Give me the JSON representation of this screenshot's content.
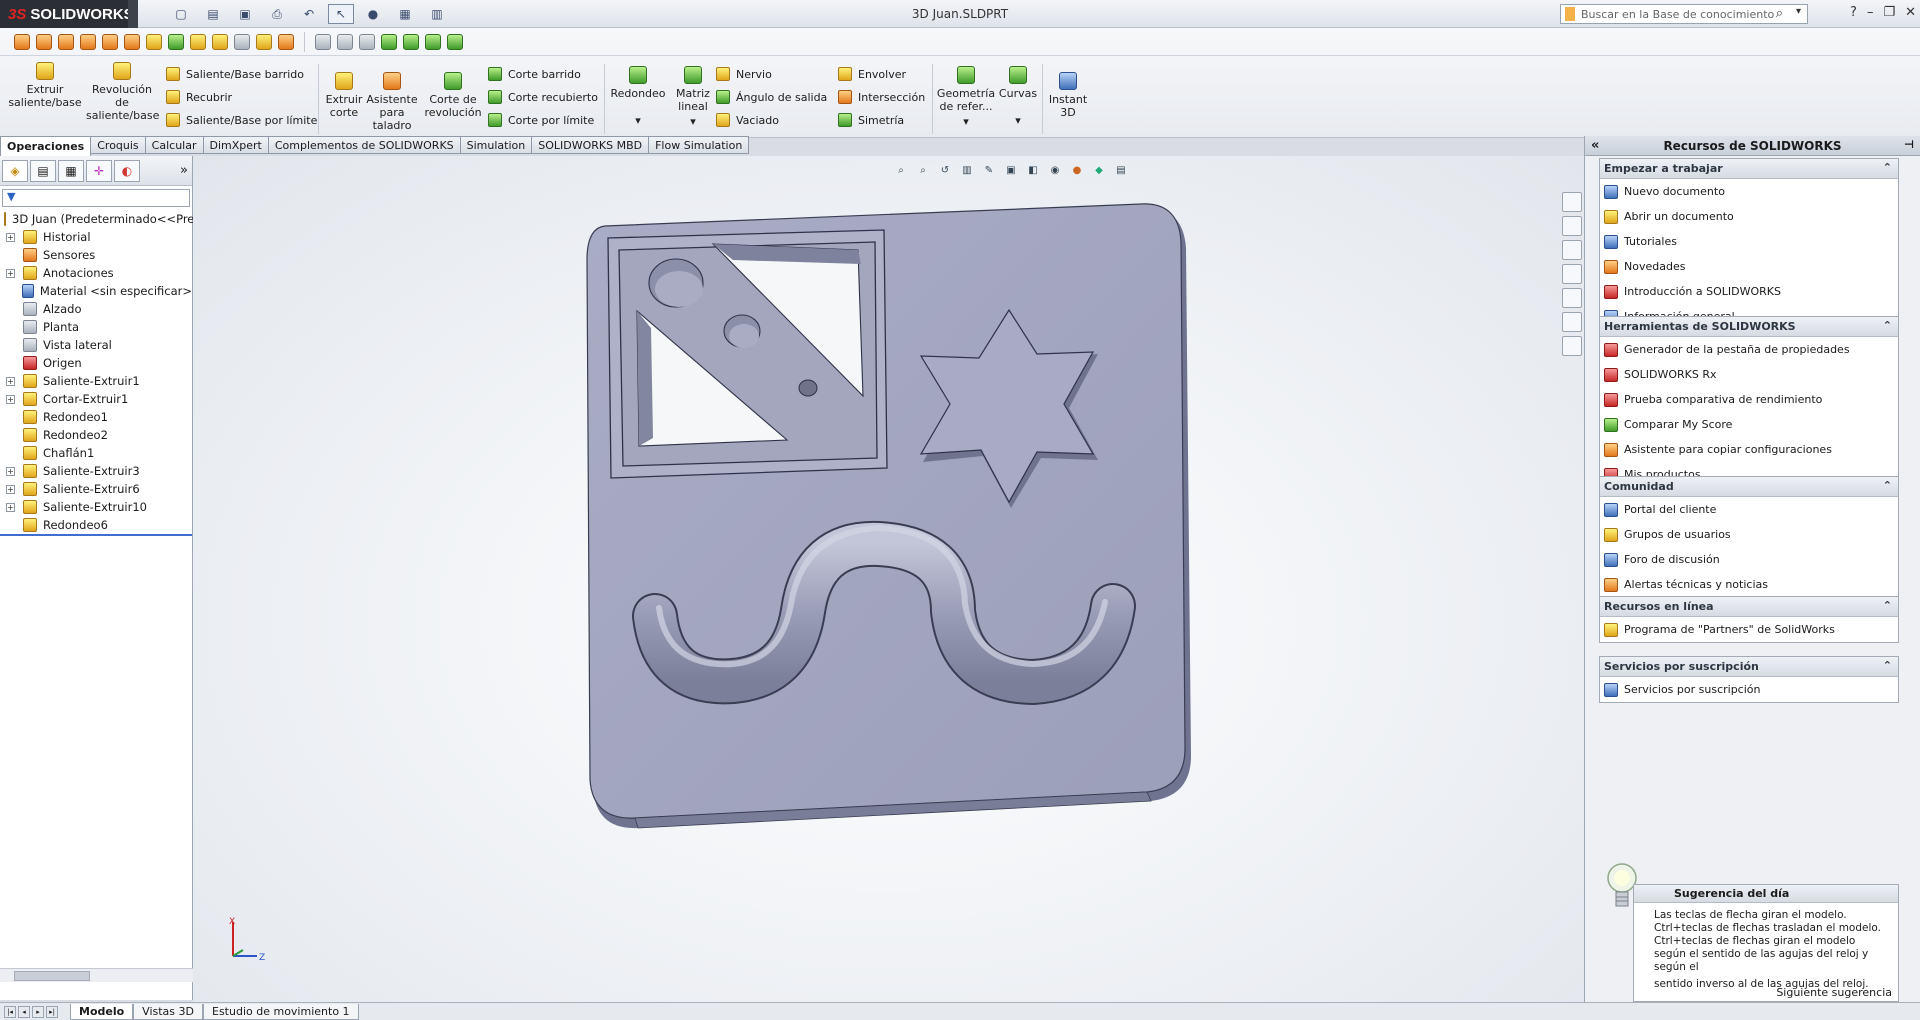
{
  "app": {
    "brand": "SOLIDWORKS",
    "brand_prefix": "3S",
    "window_title": "3D Juan.SLDPRT",
    "search_placeholder": "Buscar en la Base de conocimiento"
  },
  "ribbon": {
    "features": [
      {
        "id": "extrude",
        "label": "Extruir saliente/base",
        "color": "y"
      },
      {
        "id": "revolve",
        "label": "Revolución de saliente/base",
        "color": "y"
      }
    ],
    "small_col1": [
      {
        "label": "Saliente/Base barrido",
        "color": "y"
      },
      {
        "label": "Recubrir",
        "color": "y"
      },
      {
        "label": "Saliente/Base por límite",
        "color": "y"
      }
    ],
    "cut_buttons": [
      {
        "label": "Extruir corte",
        "color": "y"
      },
      {
        "label": "Asistente para taladro",
        "color": "o"
      },
      {
        "label": "Corte de revolución",
        "color": "g"
      }
    ],
    "small_col2": [
      {
        "label": "Corte barrido",
        "color": "g"
      },
      {
        "label": "Corte recubierto",
        "color": "g"
      },
      {
        "label": "Corte por límite",
        "color": "g"
      }
    ],
    "fillet": {
      "label": "Redondeo"
    },
    "pattern": {
      "label": "Matriz lineal"
    },
    "small_col3": [
      {
        "label": "Nervio",
        "color": "y"
      },
      {
        "label": "Ángulo de salida",
        "color": "g"
      },
      {
        "label": "Vaciado",
        "color": "y"
      }
    ],
    "small_col4": [
      {
        "label": "Envolver",
        "color": "y"
      },
      {
        "label": "Intersección",
        "color": "o"
      },
      {
        "label": "Simetría",
        "color": "g"
      }
    ],
    "refgeom": {
      "label": "Geometría de refer..."
    },
    "curves": {
      "label": "Curvas"
    },
    "instant3d": {
      "label": "Instant 3D"
    }
  },
  "tabs": [
    {
      "label": "Operaciones",
      "active": true
    },
    {
      "label": "Croquis"
    },
    {
      "label": "Calcular"
    },
    {
      "label": "DimXpert"
    },
    {
      "label": "Complementos de SOLIDWORKS"
    },
    {
      "label": "Simulation"
    },
    {
      "label": "SOLIDWORKS MBD"
    },
    {
      "label": "Flow Simulation"
    }
  ],
  "tree": {
    "root": "3D Juan  (Predeterminado<<Pre",
    "items": [
      {
        "label": "Historial",
        "exp": true,
        "color": "y"
      },
      {
        "label": "Sensores",
        "exp": false,
        "color": "o"
      },
      {
        "label": "Anotaciones",
        "exp": true,
        "color": "y"
      },
      {
        "label": "Material <sin especificar>",
        "exp": false,
        "color": "b"
      },
      {
        "label": "Alzado",
        "exp": false,
        "color": "gr"
      },
      {
        "label": "Planta",
        "exp": false,
        "color": "gr"
      },
      {
        "label": "Vista lateral",
        "exp": false,
        "color": "gr"
      },
      {
        "label": "Origen",
        "exp": false,
        "color": "r"
      },
      {
        "label": "Saliente-Extruir1",
        "exp": true,
        "color": "y"
      },
      {
        "label": "Cortar-Extruir1",
        "exp": true,
        "color": "y"
      },
      {
        "label": "Redondeo1",
        "exp": false,
        "color": "y"
      },
      {
        "label": "Redondeo2",
        "exp": false,
        "color": "y"
      },
      {
        "label": "Chaflán1",
        "exp": false,
        "color": "y"
      },
      {
        "label": "Saliente-Extruir3",
        "exp": true,
        "color": "y"
      },
      {
        "label": "Saliente-Extruir6",
        "exp": true,
        "color": "y"
      },
      {
        "label": "Saliente-Extruir10",
        "exp": true,
        "color": "y"
      },
      {
        "label": "Redondeo6",
        "exp": false,
        "color": "y"
      }
    ]
  },
  "bottom_tabs": [
    {
      "label": "Modelo",
      "active": true
    },
    {
      "label": "Vistas 3D"
    },
    {
      "label": "Estudio de movimiento 1"
    }
  ],
  "taskpane": {
    "title": "Recursos de SOLIDWORKS",
    "sections": [
      {
        "title": "Empezar a trabajar",
        "items": [
          "Nuevo documento",
          "Abrir un documento",
          "Tutoriales",
          "Novedades",
          "Introducción a SOLIDWORKS",
          "Información general"
        ]
      },
      {
        "title": "Herramientas de SOLIDWORKS",
        "items": [
          "Generador de la pestaña de propiedades",
          "SOLIDWORKS Rx",
          "Prueba comparativa de rendimiento",
          "Comparar My Score",
          "Asistente para copiar configuraciones",
          "Mis productos"
        ]
      },
      {
        "title": "Comunidad",
        "items": [
          "Portal del cliente",
          "Grupos de usuarios",
          "Foro de discusión",
          "Alertas técnicas y noticias"
        ]
      },
      {
        "title": "Recursos en línea",
        "items": [
          "Programa de \"Partners\" de SolidWorks"
        ]
      },
      {
        "title": "Servicios por suscripción",
        "items": [
          "Servicios por suscripción"
        ]
      }
    ],
    "tip": {
      "title": "Sugerencia del día",
      "text1": "Las teclas de flecha giran el modelo.",
      "text2": "Ctrl+teclas de flechas trasladan el modelo.",
      "text3": "Ctrl+teclas de flechas giran el modelo según el sentido de las agujas del reloj y según el",
      "text4": "sentido inverso al de las agujas del reloj.",
      "next": "Siguiente sugerencia"
    }
  },
  "triad": {
    "x": "X",
    "z": "Z"
  }
}
